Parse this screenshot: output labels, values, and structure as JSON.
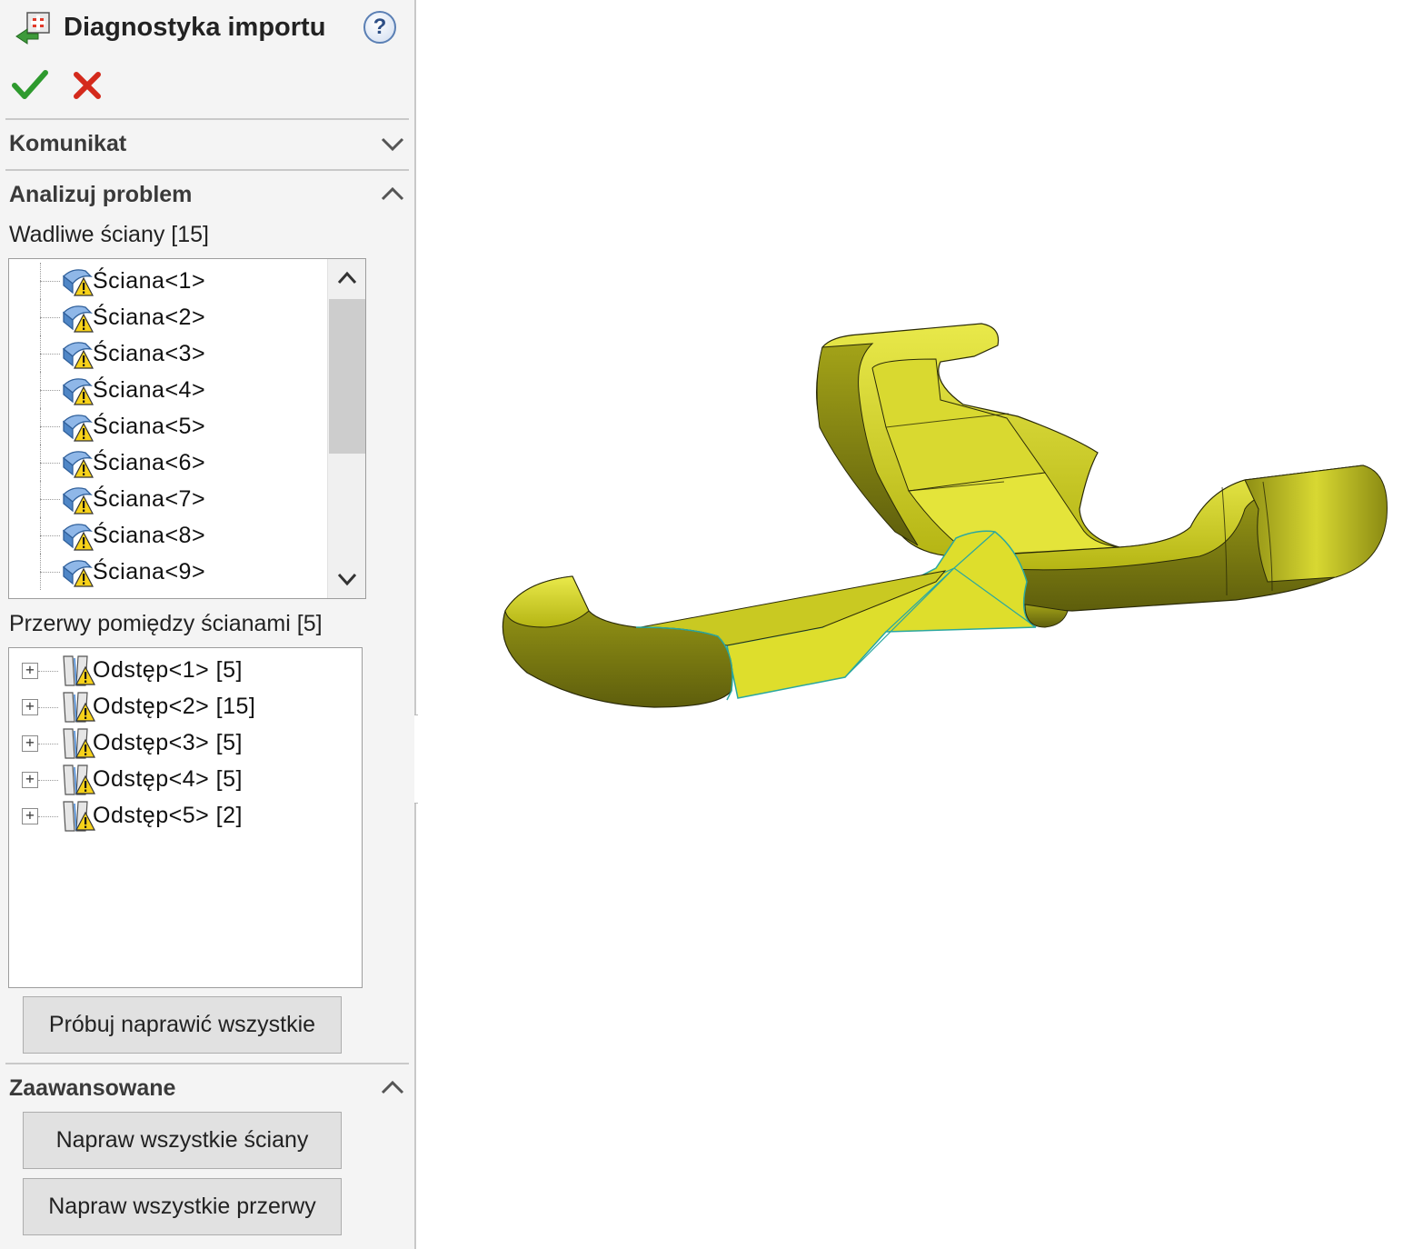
{
  "panel": {
    "title": "Diagnostyka importu",
    "help": "?",
    "sections": {
      "message": {
        "label": "Komunikat",
        "state": "collapsed"
      },
      "analyze": {
        "label": "Analizuj problem",
        "state": "expanded"
      },
      "advanced": {
        "label": "Zaawansowane",
        "state": "expanded"
      }
    },
    "faulty_faces": {
      "label": "Wadliwe ściany [15]",
      "items": [
        "Ściana<1>",
        "Ściana<2>",
        "Ściana<3>",
        "Ściana<4>",
        "Ściana<5>",
        "Ściana<6>",
        "Ściana<7>",
        "Ściana<8>",
        "Ściana<9>"
      ]
    },
    "gaps": {
      "label": "Przerwy pomiędzy ścianami [5]",
      "items": [
        "Odstęp<1> [5]",
        "Odstęp<2> [15]",
        "Odstęp<3> [5]",
        "Odstęp<4> [5]",
        "Odstęp<5> [2]"
      ]
    },
    "buttons": {
      "try_repair_all": "Próbuj naprawić wszystkie",
      "repair_all_faces": "Napraw wszystkie ściany",
      "repair_all_gaps": "Napraw wszystkie przerwy"
    }
  },
  "icons": {
    "ok": "check-icon",
    "cancel": "close-icon",
    "face": "faulty-face-icon",
    "gap": "faulty-gap-icon"
  },
  "colors": {
    "ok": "#2e9a2e",
    "cancel": "#d42a1c",
    "model_fill": "#cfcf1a",
    "model_shadow": "#6f6f12",
    "edge_highlight": "#2aa7a0"
  }
}
